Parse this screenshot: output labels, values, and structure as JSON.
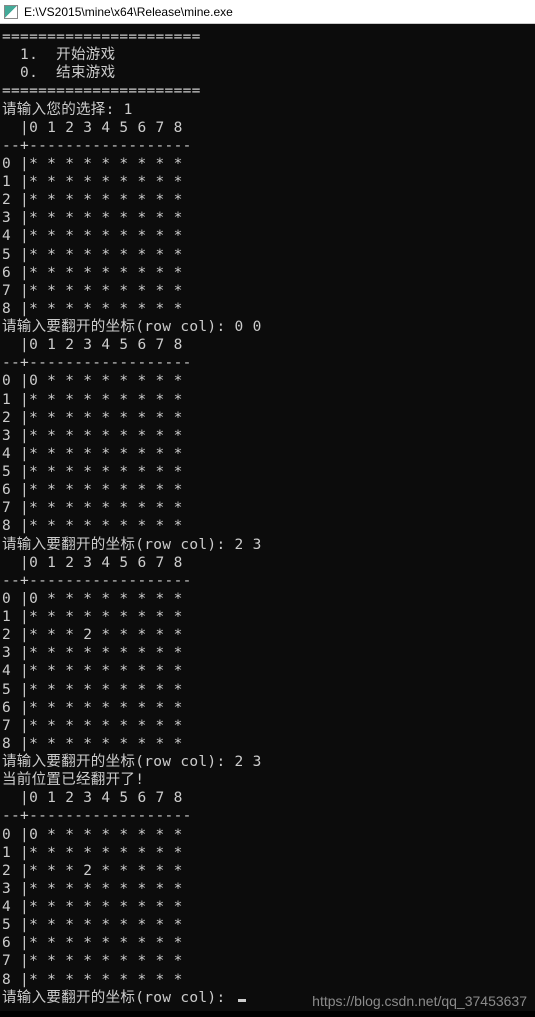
{
  "window": {
    "title": "E:\\VS2015\\mine\\x64\\Release\\mine.exe"
  },
  "console": {
    "divider": "======================",
    "divider2": "======================",
    "menu": {
      "item1": "  1.  开始游戏",
      "item0": "  0.  结束游戏"
    },
    "prompt_choice": "请输入您的选择: ",
    "choice_input": "1",
    "col_header": "  |0 1 2 3 4 5 6 7 8",
    "row_sep": "--+------------------",
    "board1_rows": [
      "0 |* * * * * * * * *",
      "1 |* * * * * * * * *",
      "2 |* * * * * * * * *",
      "3 |* * * * * * * * *",
      "4 |* * * * * * * * *",
      "5 |* * * * * * * * *",
      "6 |* * * * * * * * *",
      "7 |* * * * * * * * *",
      "8 |* * * * * * * * *"
    ],
    "prompt_coord": "请输入要翻开的坐标(row col): ",
    "coord1": "0 0",
    "board2_rows": [
      "0 |0 * * * * * * * *",
      "1 |* * * * * * * * *",
      "2 |* * * * * * * * *",
      "3 |* * * * * * * * *",
      "4 |* * * * * * * * *",
      "5 |* * * * * * * * *",
      "6 |* * * * * * * * *",
      "7 |* * * * * * * * *",
      "8 |* * * * * * * * *"
    ],
    "coord2": "2 3",
    "board3_rows": [
      "0 |0 * * * * * * * *",
      "1 |* * * * * * * * *",
      "2 |* * * 2 * * * * *",
      "3 |* * * * * * * * *",
      "4 |* * * * * * * * *",
      "5 |* * * * * * * * *",
      "6 |* * * * * * * * *",
      "7 |* * * * * * * * *",
      "8 |* * * * * * * * *"
    ],
    "coord3": "2 3",
    "already_open": "当前位置已经翻开了!",
    "board4_rows": [
      "0 |0 * * * * * * * *",
      "1 |* * * * * * * * *",
      "2 |* * * 2 * * * * *",
      "3 |* * * * * * * * *",
      "4 |* * * * * * * * *",
      "5 |* * * * * * * * *",
      "6 |* * * * * * * * *",
      "7 |* * * * * * * * *",
      "8 |* * * * * * * * *"
    ]
  },
  "watermark": "https://blog.csdn.net/qq_37453637"
}
